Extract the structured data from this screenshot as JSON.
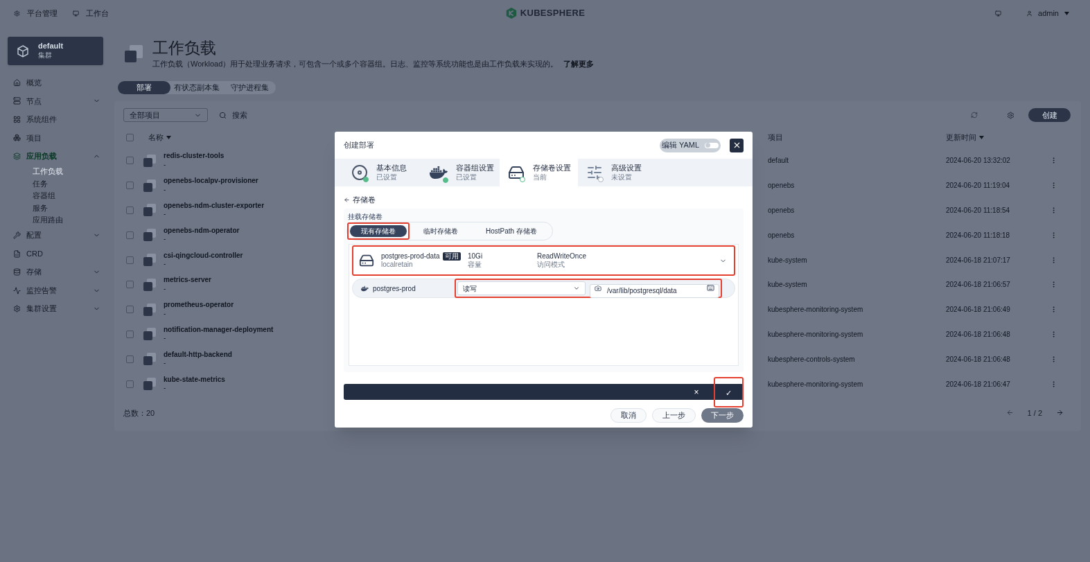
{
  "topbar": {
    "links": [
      {
        "label": "平台管理"
      },
      {
        "label": "工作台"
      }
    ],
    "logo": "KUBESPHERE",
    "user": "admin"
  },
  "sidebar": {
    "cluster": {
      "name": "default",
      "type": "集群"
    },
    "items": [
      {
        "label": "概览",
        "kind": "link",
        "selected": false
      },
      {
        "label": "节点",
        "kind": "group",
        "expanded": false,
        "selected": false
      },
      {
        "label": "系统组件",
        "kind": "link",
        "selected": false
      },
      {
        "label": "项目",
        "kind": "link",
        "selected": false
      },
      {
        "label": "应用负载",
        "kind": "group",
        "expanded": true,
        "selected": true,
        "children": [
          {
            "label": "工作负载",
            "selected": true
          },
          {
            "label": "任务",
            "selected": false
          },
          {
            "label": "容器组",
            "selected": false
          },
          {
            "label": "服务",
            "selected": false
          },
          {
            "label": "应用路由",
            "selected": false
          }
        ]
      },
      {
        "label": "配置",
        "kind": "group",
        "expanded": false,
        "selected": false
      },
      {
        "label": "CRD",
        "kind": "link",
        "selected": false
      },
      {
        "label": "存储",
        "kind": "group",
        "expanded": false,
        "selected": false
      },
      {
        "label": "监控告警",
        "kind": "group",
        "expanded": false,
        "selected": false
      },
      {
        "label": "集群设置",
        "kind": "group",
        "expanded": false,
        "selected": false
      }
    ]
  },
  "page": {
    "title": "工作负载",
    "description": "工作负载（Workload）用于处理业务请求，可包含一个或多个容器组。日志、监控等系统功能也是由工作负载来实现的。",
    "learn_more": "了解更多",
    "tabs": [
      {
        "label": "部署",
        "selected": true
      },
      {
        "label": "有状态副本集",
        "selected": false
      },
      {
        "label": "守护进程集",
        "selected": false
      }
    ],
    "project_filter": "全部项目",
    "search": {
      "placeholder": "搜索"
    },
    "create_button": "创建",
    "table": {
      "all_checked": false,
      "columns": [
        "名称",
        "项目",
        "更新时间"
      ],
      "rows": [
        {
          "name": "redis-cluster-tools",
          "description": "-",
          "project": "default",
          "updated": "2024-06-20 13:32:02",
          "checked": false
        },
        {
          "name": "openebs-localpv-provisioner",
          "description": "-",
          "project": "openebs",
          "updated": "2024-06-20 11:19:04",
          "checked": false
        },
        {
          "name": "openebs-ndm-cluster-exporter",
          "description": "-",
          "project": "openebs",
          "updated": "2024-06-20 11:18:54",
          "checked": false
        },
        {
          "name": "openebs-ndm-operator",
          "description": "-",
          "project": "openebs",
          "updated": "2024-06-20 11:18:18",
          "checked": false
        },
        {
          "name": "csi-qingcloud-controller",
          "description": "-",
          "project": "kube-system",
          "updated": "2024-06-18 21:07:17",
          "checked": false
        },
        {
          "name": "metrics-server",
          "description": "-",
          "project": "kube-system",
          "updated": "2024-06-18 21:06:57",
          "checked": false
        },
        {
          "name": "prometheus-operator",
          "description": "-",
          "project": "kubesphere-monitoring-system",
          "updated": "2024-06-18 21:06:49",
          "checked": false
        },
        {
          "name": "notification-manager-deployment",
          "description": "-",
          "project": "kubesphere-monitoring-system",
          "updated": "2024-06-18 21:06:48",
          "checked": false
        },
        {
          "name": "default-http-backend",
          "description": "-",
          "project": "kubesphere-controls-system",
          "updated": "2024-06-18 21:06:48",
          "checked": false
        },
        {
          "name": "kube-state-metrics",
          "description": "-",
          "project": "kubesphere-monitoring-system",
          "updated": "2024-06-18 21:06:47",
          "checked": false
        }
      ]
    },
    "total": "总数：20",
    "pagination": "1 / 2"
  },
  "modal": {
    "title": "创建部署",
    "yaml_toggle": {
      "label": "编辑 YAML",
      "on": false
    },
    "steps": [
      {
        "title": "基本信息",
        "status_text": "已设置",
        "done": true,
        "current": false
      },
      {
        "title": "容器组设置",
        "status_text": "已设置",
        "done": true,
        "current": false
      },
      {
        "title": "存储卷设置",
        "status_text": "当前",
        "done": false,
        "current": true
      },
      {
        "title": "高级设置",
        "status_text": "未设置",
        "done": false,
        "current": false
      }
    ],
    "back_link": "存储卷",
    "section_label": "挂载存储卷",
    "source_tabs": [
      {
        "label": "现有存储卷",
        "selected": true,
        "highlighted": true
      },
      {
        "label": "临时存储卷",
        "selected": false,
        "highlighted": false
      },
      {
        "label": "HostPath 存储卷",
        "selected": false,
        "highlighted": false
      }
    ],
    "volume": {
      "name": "postgres-prod-data",
      "badge": "可用",
      "storage_class": "localretain",
      "capacity": "10Gi",
      "capacity_label": "容量",
      "access_mode": "ReadWriteOnce",
      "access_mode_label": "访问模式",
      "highlighted": true
    },
    "mount": {
      "container": "postgres-prod",
      "mode": "读写",
      "path": "/var/lib/postgresql/data",
      "highlighted": true
    },
    "action_bar": {
      "cancel": "×",
      "confirm": "✓",
      "confirm_highlighted": true
    },
    "buttons": [
      {
        "label": "取消",
        "kind": "secondary"
      },
      {
        "label": "上一步",
        "kind": "secondary"
      },
      {
        "label": "下一步",
        "kind": "primary"
      }
    ]
  }
}
